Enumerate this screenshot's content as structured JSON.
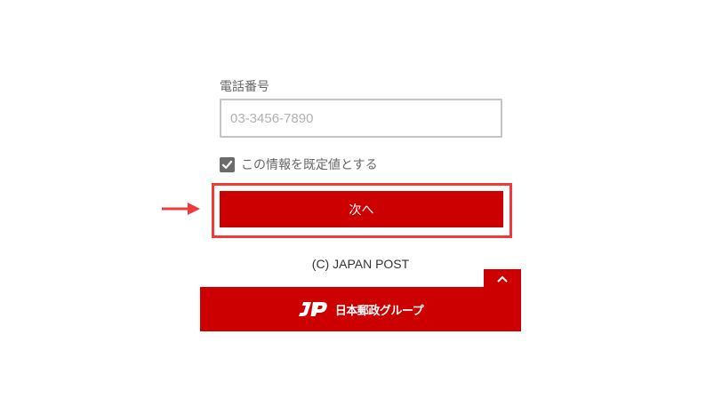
{
  "form": {
    "phone_label": "電話番号",
    "phone_placeholder": "03-3456-7890",
    "phone_value": "",
    "set_default_label": "この情報を既定値とする",
    "set_default_checked": true,
    "next_label": "次へ"
  },
  "footer": {
    "copyright": "(C) JAPAN POST",
    "logo_icon": "jp-logo-icon",
    "group_name": "日本郵政グループ",
    "back_to_top_icon": "chevron-up-icon"
  },
  "colors": {
    "brand_red": "#cc0000",
    "highlight_red": "#ee3a3a",
    "checkbox_gray": "#6b6b6b"
  }
}
